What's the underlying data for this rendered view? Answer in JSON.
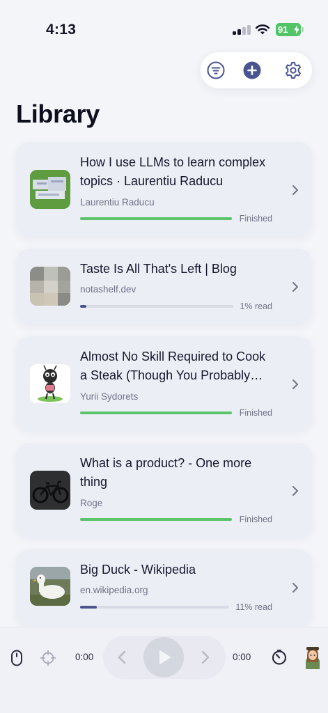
{
  "status_bar": {
    "time": "4:13",
    "battery": "91"
  },
  "title": "Library",
  "items": [
    {
      "title": "How I use LLMs to learn complex topics · Laurentiu Raducu",
      "subtitle": "Laurentiu Raducu",
      "status": "Finished",
      "progress": 1.0,
      "thumb": "ui-screenshot-thumbnail"
    },
    {
      "title": "Taste Is All That's Left | Blog",
      "subtitle": "notashelf.dev",
      "status": "1% read",
      "progress": 0.01,
      "thumb": "blurred-portrait-thumbnail"
    },
    {
      "title": "Almost No Skill Required to Cook a Steak (Though You Probably Shouldn't)",
      "subtitle": "Yurii Sydorets",
      "status": "Finished",
      "progress": 1.0,
      "thumb": "cartoon-ant-thumbnail"
    },
    {
      "title": "What is a product? - One more thing",
      "subtitle": "Roge",
      "status": "Finished",
      "progress": 1.0,
      "thumb": "bicycle-thumbnail"
    },
    {
      "title": "Big Duck - Wikipedia",
      "subtitle": "en.wikipedia.org",
      "status": "11% read",
      "progress": 0.11,
      "thumb": "white-duck-thumbnail"
    }
  ],
  "player": {
    "elapsed": "0:00",
    "remaining": "0:00"
  },
  "colors": {
    "accent": "#4a5590",
    "finished": "#5cc46b",
    "track": "#d8dae5",
    "card": "#eceef6"
  }
}
